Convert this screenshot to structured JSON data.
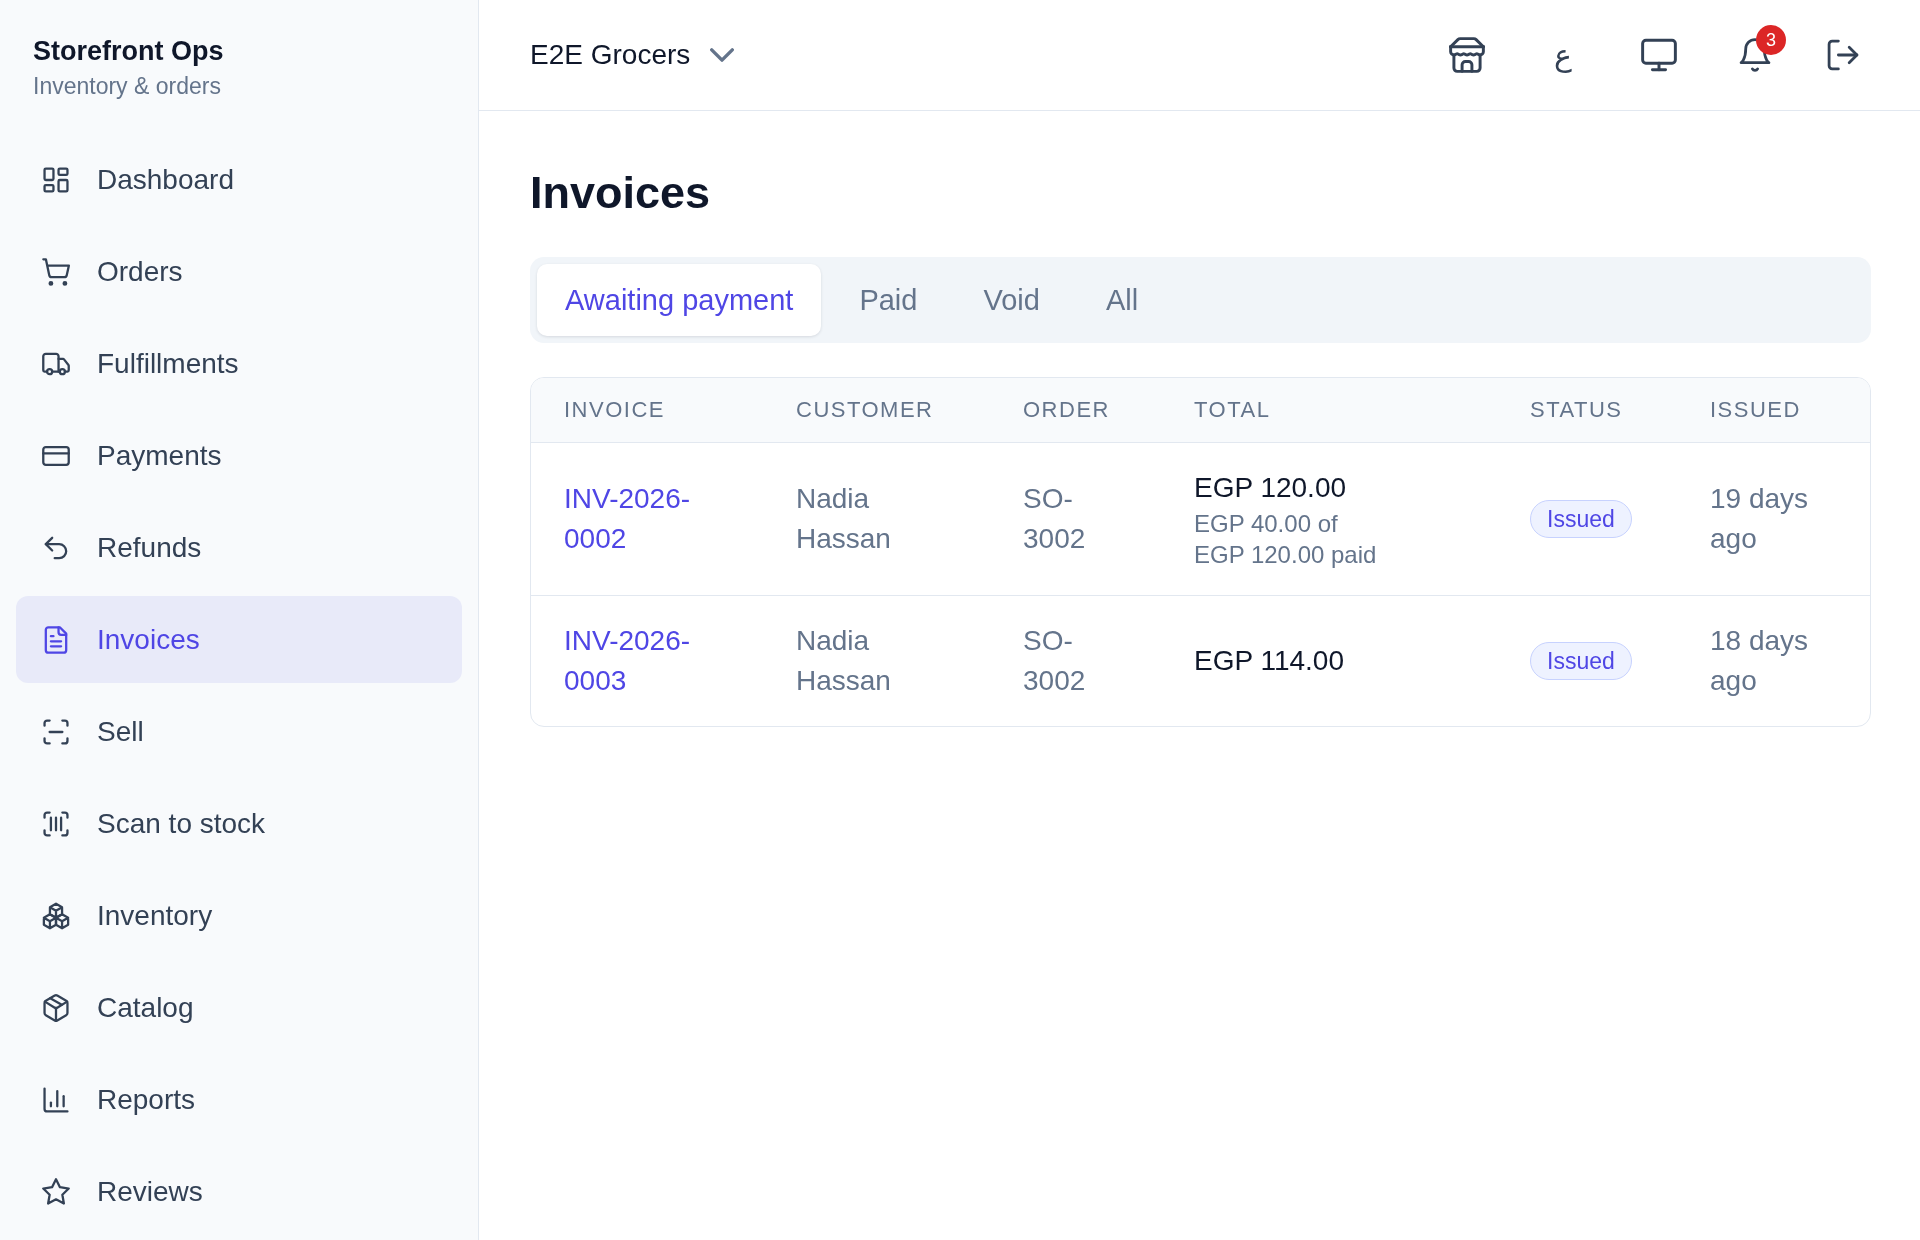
{
  "sidebar": {
    "brand": {
      "title": "Storefront Ops",
      "subtitle": "Inventory & orders"
    },
    "items": [
      {
        "label": "Dashboard",
        "selected": false
      },
      {
        "label": "Orders",
        "selected": false
      },
      {
        "label": "Fulfillments",
        "selected": false
      },
      {
        "label": "Payments",
        "selected": false
      },
      {
        "label": "Refunds",
        "selected": false
      },
      {
        "label": "Invoices",
        "selected": true
      },
      {
        "label": "Sell",
        "selected": false
      },
      {
        "label": "Scan to stock",
        "selected": false
      },
      {
        "label": "Inventory",
        "selected": false
      },
      {
        "label": "Catalog",
        "selected": false
      },
      {
        "label": "Reports",
        "selected": false
      },
      {
        "label": "Reviews",
        "selected": false
      }
    ]
  },
  "top_bar": {
    "store_selector": {
      "value": "E2E Grocers"
    },
    "language_button": {
      "label": "ع"
    },
    "notifications": {
      "count": "3"
    }
  },
  "page": {
    "title": "Invoices",
    "tabs": [
      {
        "label": "Awaiting payment",
        "selected": true
      },
      {
        "label": "Paid",
        "selected": false
      },
      {
        "label": "Void",
        "selected": false
      },
      {
        "label": "All",
        "selected": false
      }
    ],
    "table": {
      "columns": [
        "INVOICE",
        "CUSTOMER",
        "ORDER",
        "TOTAL",
        "STATUS",
        "ISSUED"
      ],
      "rows": [
        {
          "invoice": "INV-2026-0002",
          "customer": "Nadia Hassan",
          "order": "SO-3002",
          "total": "EGP 120.00",
          "payment_note": "EGP 40.00 of EGP 120.00 paid",
          "status": "Issued",
          "issued": "19 days ago"
        },
        {
          "invoice": "INV-2026-0003",
          "customer": "Nadia Hassan",
          "order": "SO-3002",
          "total": "EGP 114.00",
          "status": "Issued",
          "issued": "18 days ago"
        }
      ]
    }
  }
}
